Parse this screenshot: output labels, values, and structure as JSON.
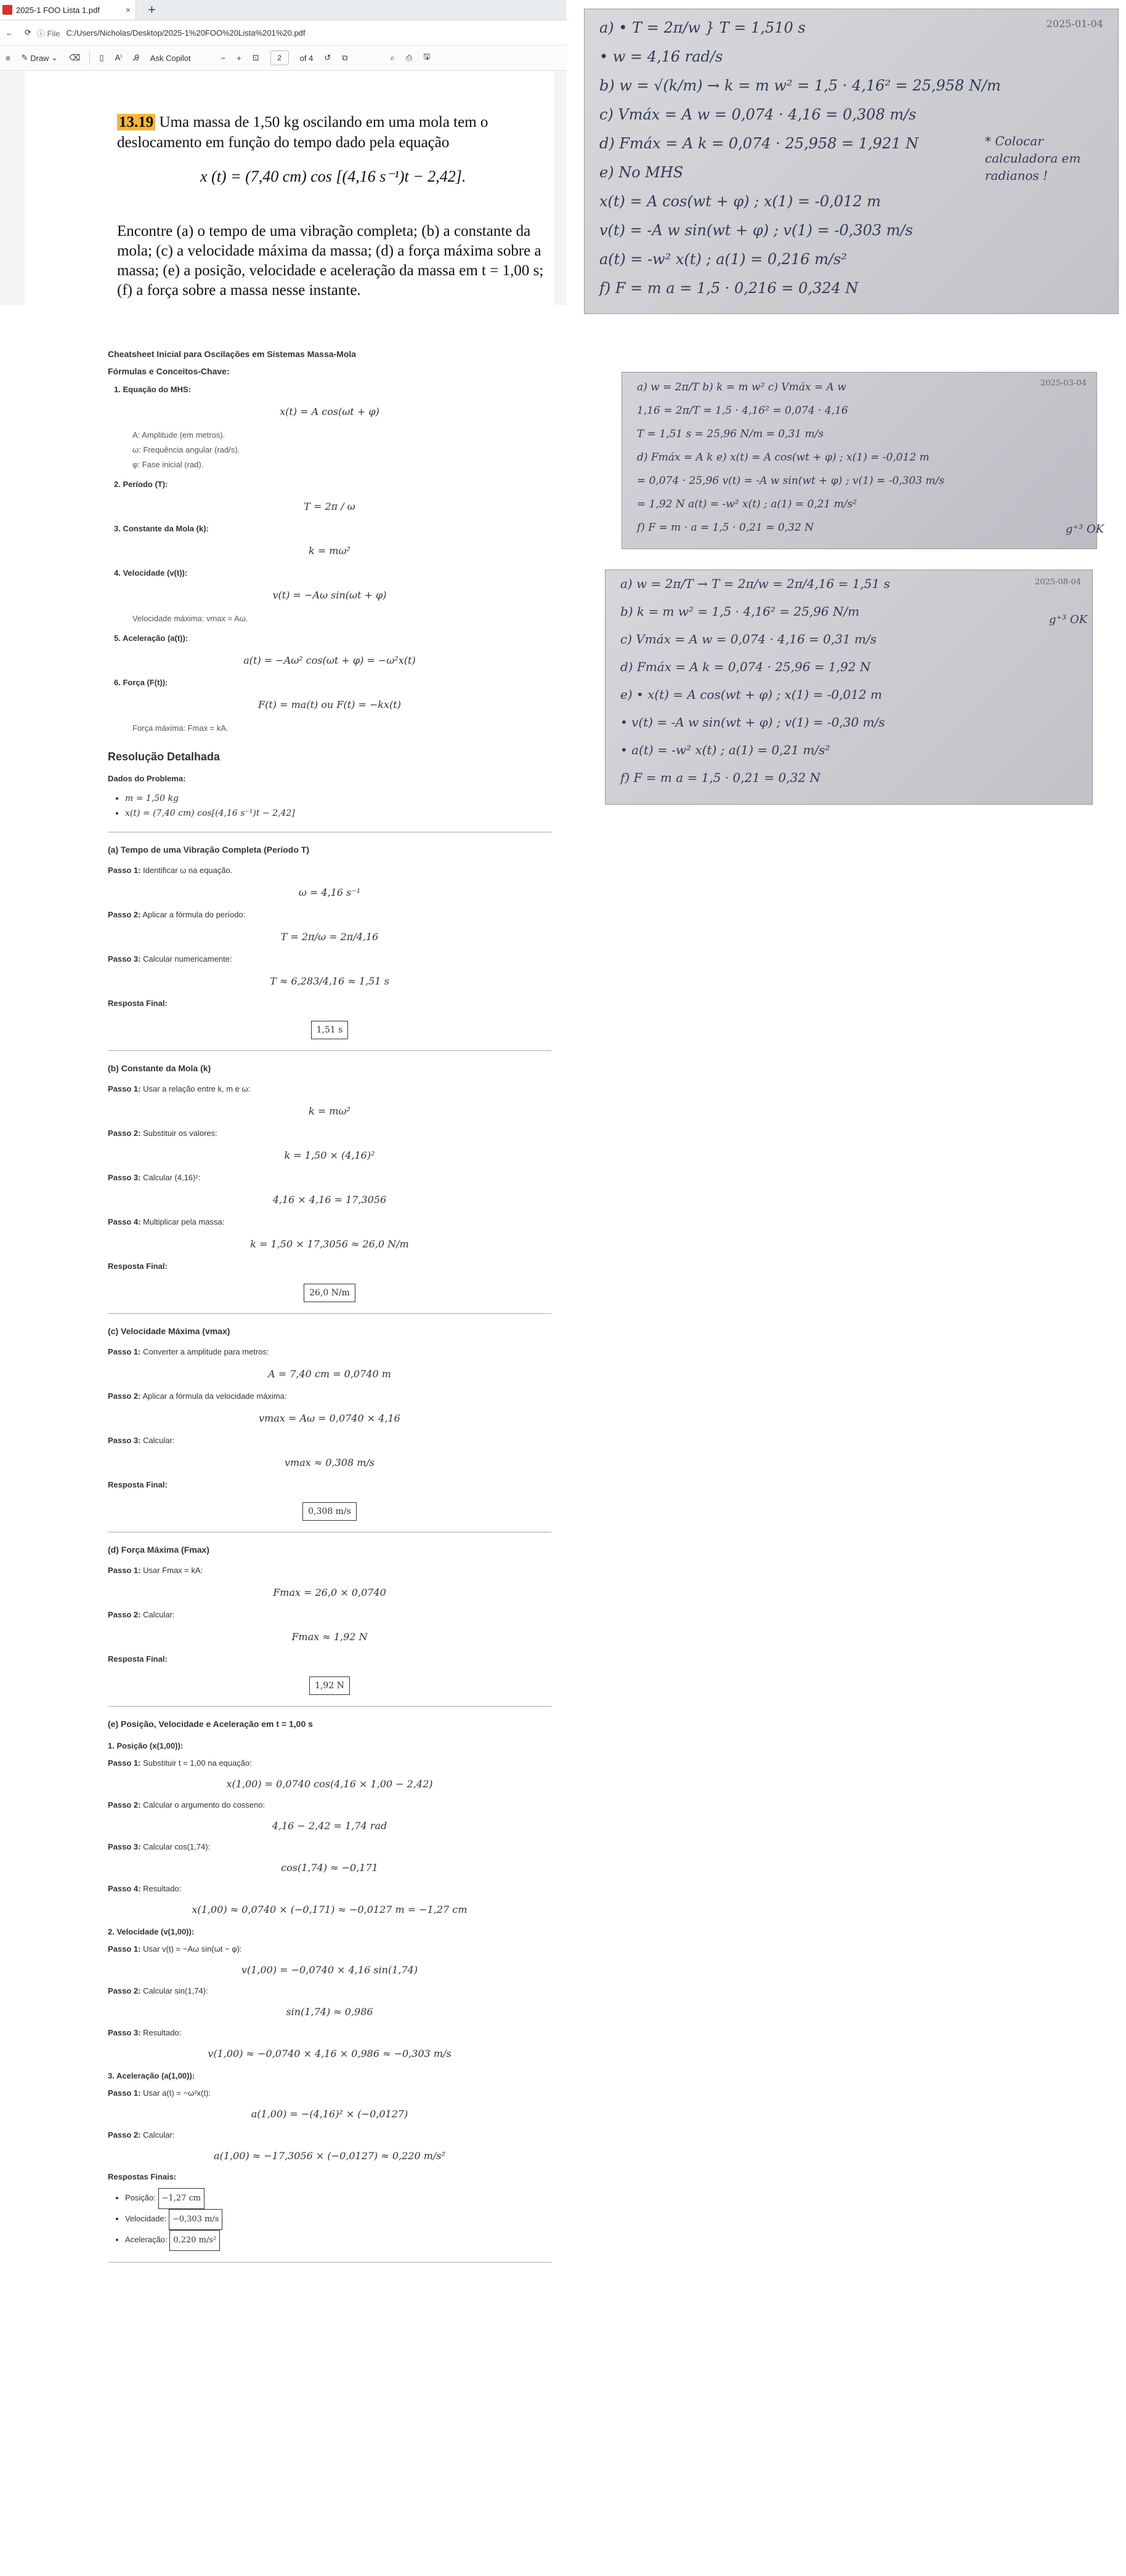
{
  "browser": {
    "tab_title": "2025-1 FOO Lista 1.pdf",
    "tab_close": "×",
    "new_tab": "+",
    "file_label": "File",
    "url": "C:/Users/Nicholas/Desktop/2025-1%20FOO%20Lista%201%20.pdf"
  },
  "toolbar": {
    "draw_label": "Draw",
    "copilot_label": "Ask Copilot",
    "minus": "−",
    "plus": "+",
    "page_current": "2",
    "page_total": "of 4"
  },
  "problem": {
    "number": "13.19",
    "statement": "Uma massa de 1,50 kg oscilando em uma mola tem o deslocamento em função do tempo dado pela equação",
    "equation": "x (t) = (7,40 cm) cos [(4,16 s⁻¹)t − 2,42].",
    "tasks": "Encontre (a) o tempo de uma vibração completa; (b) a constante da mola; (c) a velocidade máxima da massa; (d) a força máxima sobre a massa; (e) a posição, velocidade e aceleração da massa em t = 1,00 s; (f) a força sobre a massa nesse instante."
  },
  "photo1": {
    "date": "2025-01-04",
    "lines": [
      "a) • T = 2π/w   } T = 1,510 s",
      "   • w = 4,16 rad/s",
      "b) w = √(k/m) → k = m w² = 1,5 · 4,16² = 25,958 N/m",
      "c) Vmáx = A w = 0,074 · 4,16 = 0,308 m/s",
      "d) Fmáx = A k = 0,074 · 25,958 = 1,921 N",
      "e) No MHS",
      "   x(t) = A cos(wt + φ)        ; x(1) = -0,012 m",
      "   v(t) = -A w sin(wt + φ)    ; v(1) = -0,303 m/s",
      "   a(t) = -w² x(t)              ; a(1) = 0,216 m/s²",
      "f) F = m a = 1,5 · 0,216 = 0,324 N"
    ],
    "note": "* Colocar calculadora em radianos !"
  },
  "photo2": {
    "date": "2025-03-04",
    "lines": [
      "a) w = 2π/T      b) k = m w²           c) Vmáx = A w",
      "   1,16 = 2π/T       = 1,5 · 4,16²          = 0,074 · 4,16",
      "   T = 1,51 s        = 25,96 N/m           = 0,31 m/s",
      "d) Fmáx = A k     e) x(t) = A cos(wt + φ)   ; x(1) = -0,012 m",
      "   = 0,074 · 25,96     v(t) = -A w sin(wt + φ) ; v(1) = -0,303 m/s",
      "   = 1,92 N            a(t) = -w² x(t)         ; a(1) = 0,21 m/s²",
      "                    f) F = m · a = 1,5 · 0,21 = 0,32 N"
    ],
    "note": "g⁺³ OK"
  },
  "photo3": {
    "date": "2025-08-04",
    "lines": [
      "a) w = 2π/T  → T = 2π/w = 2π/4,16 = 1,51 s",
      "b) k = m w² = 1,5 · 4,16² = 25,96 N/m",
      "c) Vmáx = A w = 0,074 · 4,16 = 0,31 m/s",
      "d) Fmáx = A k = 0,074 · 25,96 = 1,92 N",
      "e) • x(t) = A cos(wt + φ)       ; x(1) = -0,012 m",
      "   • v(t) = -A w sin(wt + φ)   ; v(1) = -0,30 m/s",
      "   • a(t) = -w² x(t)             ; a(1) = 0,21 m/s²",
      "f) F = m a = 1,5 · 0,21 = 0,32 N"
    ],
    "note": "g⁺³ OK"
  },
  "cheatsheet": {
    "title": "Cheatsheet Inicial para Oscilações em Sistemas Massa-Mola",
    "subtitle": "Fórmulas e Conceitos-Chave:",
    "items": [
      {
        "label": "1. Equação do MHS:",
        "formula": "x(t) = A cos(ωt + φ)",
        "notes": [
          "A: Amplitude (em metros).",
          "ω: Frequência angular (rad/s).",
          "φ: Fase inicial (rad)."
        ]
      },
      {
        "label": "2. Período (T):",
        "formula": "T = 2π / ω",
        "notes": []
      },
      {
        "label": "3. Constante da Mola (k):",
        "formula": "k = mω²",
        "notes": []
      },
      {
        "label": "4. Velocidade (v(t)):",
        "formula": "v(t) = −Aω sin(ωt + φ)",
        "notes": [
          "Velocidade máxima: vmax = Aω."
        ]
      },
      {
        "label": "5. Aceleração (a(t)):",
        "formula": "a(t) = −Aω² cos(ωt + φ) = −ω²x(t)",
        "notes": []
      },
      {
        "label": "6. Força (F(t)):",
        "formula": "F(t) = ma(t)   ou   F(t) = −kx(t)",
        "notes": [
          "Força máxima: Fmax = kA."
        ]
      }
    ]
  },
  "resolution": {
    "title": "Resolução Detalhada",
    "data_title": "Dados do Problema:",
    "data": [
      "m = 1,50 kg",
      "x(t) = (7,40 cm) cos[(4,16 s⁻¹)t − 2,42]"
    ],
    "final_label": "Resposta Final:",
    "sections": [
      {
        "title": "(a) Tempo de uma Vibração Completa (Período T)",
        "steps": [
          {
            "label": "Passo 1:",
            "text": "Identificar ω na equação.",
            "formula": "ω = 4,16 s⁻¹"
          },
          {
            "label": "Passo 2:",
            "text": "Aplicar a fórmula do período:",
            "formula": "T = 2π/ω = 2π/4,16"
          },
          {
            "label": "Passo 3:",
            "text": "Calcular numericamente:",
            "formula": "T ≈ 6,283/4,16 ≈ 1,51 s"
          }
        ],
        "answer": "1,51 s"
      },
      {
        "title": "(b) Constante da Mola (k)",
        "steps": [
          {
            "label": "Passo 1:",
            "text": "Usar a relação entre k, m e ω:",
            "formula": "k = mω²"
          },
          {
            "label": "Passo 2:",
            "text": "Substituir os valores:",
            "formula": "k = 1,50 × (4,16)²"
          },
          {
            "label": "Passo 3:",
            "text": "Calcular (4,16)²:",
            "formula": "4,16 × 4,16 = 17,3056"
          },
          {
            "label": "Passo 4:",
            "text": "Multiplicar pela massa:",
            "formula": "k = 1,50 × 17,3056 ≈ 26,0 N/m"
          }
        ],
        "answer": "26,0 N/m"
      },
      {
        "title": "(c) Velocidade Máxima (vmax)",
        "steps": [
          {
            "label": "Passo 1:",
            "text": "Converter a amplitude para metros:",
            "formula": "A = 7,40 cm = 0,0740 m"
          },
          {
            "label": "Passo 2:",
            "text": "Aplicar a fórmula da velocidade máxima:",
            "formula": "vmax = Aω = 0,0740 × 4,16"
          },
          {
            "label": "Passo 3:",
            "text": "Calcular:",
            "formula": "vmax ≈ 0,308 m/s"
          }
        ],
        "answer": "0,308 m/s"
      },
      {
        "title": "(d) Força Máxima (Fmax)",
        "steps": [
          {
            "label": "Passo 1:",
            "text": "Usar Fmax = kA:",
            "formula": "Fmax = 26,0 × 0,0740"
          },
          {
            "label": "Passo 2:",
            "text": "Calcular:",
            "formula": "Fmax ≈ 1,92 N"
          }
        ],
        "answer": "1,92 N"
      }
    ],
    "part_e": {
      "title": "(e) Posição, Velocidade e Aceleração em t = 1,00 s",
      "blocks": [
        {
          "heading": "1. Posição (x(1,00)):",
          "steps": [
            {
              "label": "Passo 1:",
              "text": "Substituir t = 1,00 na equação:",
              "formula": "x(1,00) = 0,0740 cos(4,16 × 1,00 − 2,42)"
            },
            {
              "label": "Passo 2:",
              "text": "Calcular o argumento do cosseno:",
              "formula": "4,16 − 2,42 = 1,74 rad"
            },
            {
              "label": "Passo 3:",
              "text": "Calcular cos(1,74):",
              "formula": "cos(1,74) ≈ −0,171"
            },
            {
              "label": "Passo 4:",
              "text": "Resultado:",
              "formula": "x(1,00) ≈ 0,0740 × (−0,171) ≈ −0,0127 m = −1,27 cm"
            }
          ]
        },
        {
          "heading": "2. Velocidade (v(1,00)):",
          "steps": [
            {
              "label": "Passo 1:",
              "text": "Usar v(t) = −Aω sin(ωt − φ):",
              "formula": "v(1,00) = −0,0740 × 4,16 sin(1,74)"
            },
            {
              "label": "Passo 2:",
              "text": "Calcular sin(1,74):",
              "formula": "sin(1,74) ≈ 0,986"
            },
            {
              "label": "Passo 3:",
              "text": "Resultado:",
              "formula": "v(1,00) ≈ −0,0740 × 4,16 × 0,986 ≈ −0,303 m/s"
            }
          ]
        },
        {
          "heading": "3. Aceleração (a(1,00)):",
          "steps": [
            {
              "label": "Passo 1:",
              "text": "Usar a(t) = −ω²x(t):",
              "formula": "a(1,00) = −(4,16)² × (−0,0127)"
            },
            {
              "label": "Passo 2:",
              "text": "Calcular:",
              "formula": "a(1,00) ≈ −17,3056 × (−0,0127) ≈ 0,220 m/s²"
            }
          ]
        }
      ],
      "final_title": "Respostas Finais:",
      "finals": [
        {
          "label": "Posição:",
          "value": "−1,27 cm"
        },
        {
          "label": "Velocidade:",
          "value": "−0,303 m/s"
        },
        {
          "label": "Aceleração:",
          "value": "0,220 m/s²"
        }
      ]
    }
  }
}
